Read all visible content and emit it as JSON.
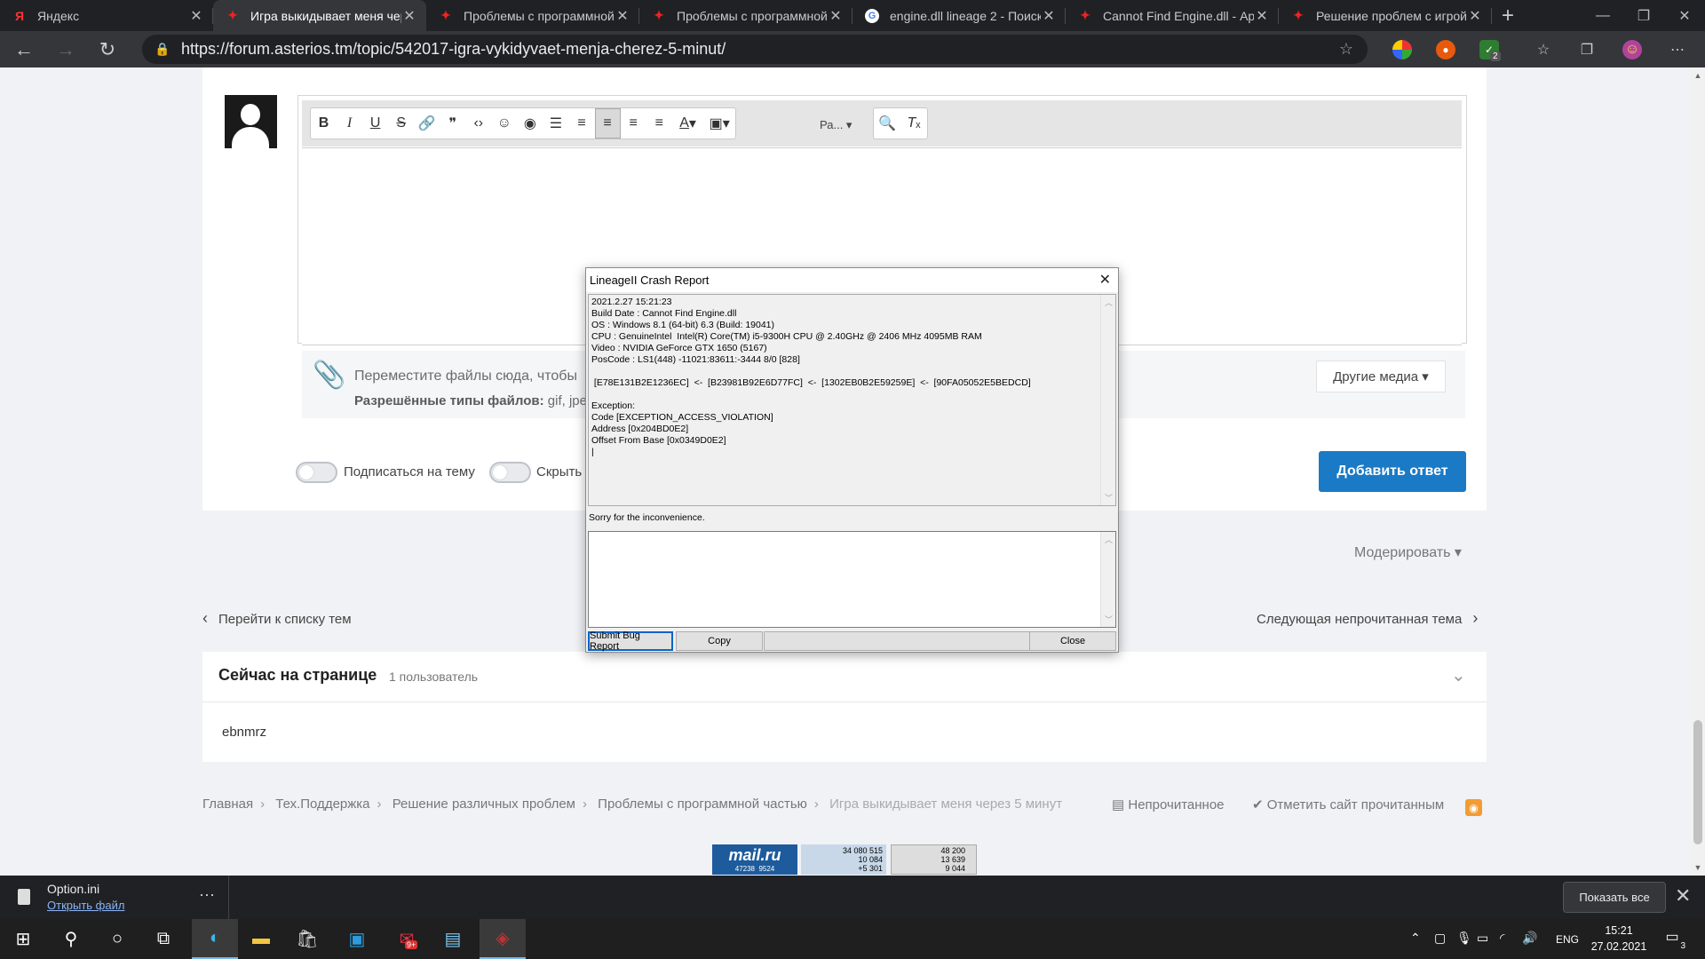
{
  "browser": {
    "tabs": [
      {
        "title": "Яндекс",
        "favicon": "yandex-icon",
        "active": false
      },
      {
        "title": "Игра выкидывает меня чере",
        "favicon": "asterios-icon",
        "active": true
      },
      {
        "title": "Проблемы с программной",
        "favicon": "asterios-icon",
        "active": false
      },
      {
        "title": "Проблемы с программной",
        "favicon": "asterios-icon",
        "active": false
      },
      {
        "title": "engine.dll lineage 2 - Поиск",
        "favicon": "google-icon",
        "active": false
      },
      {
        "title": "Cannot Find Engine.dll - Ар",
        "favicon": "asterios-icon",
        "active": false
      },
      {
        "title": "Решение проблем с игрой",
        "favicon": "asterios-icon",
        "active": false
      }
    ],
    "url": "https://forum.asterios.tm/topic/542017-igra-vykidyvaet-menja-cherez-5-minut/",
    "extension_badge": "2"
  },
  "editor": {
    "font_menu_label": "Ра...",
    "attach_text": "Переместите файлы сюда, чтобы",
    "allowed_label": "Разрешённые типы файлов:",
    "allowed_types": "gif, jpeg",
    "other_media_label": "Другие медиа ▾",
    "subscribe_label": "Подписаться на тему",
    "hide_label": "Скрыть",
    "submit_label": "Добавить ответ"
  },
  "page": {
    "moderate_label": "Модерировать ▾",
    "back_to_list": "Перейти к списку тем",
    "next_unread": "Следующая непрочитанная тема",
    "online_title": "Сейчас на странице",
    "online_count": "1 пользователь",
    "online_user": "ebnmrz",
    "breadcrumbs": [
      "Главная",
      "Тех.Поддержка",
      "Решение различных проблем",
      "Проблемы с программной частью",
      "Игра выкидывает меня через 5 минут"
    ],
    "unread_link": "Непрочитанное",
    "mark_read_link": "Отметить сайт прочитанным",
    "counter_mailru": "mail.ru",
    "counter_mailru_nums": [
      "47238",
      "9524"
    ],
    "counter_hotlog_nums": [
      "34 080 515",
      "10 084",
      "+5 301"
    ],
    "counter_li_nums": [
      "48 200",
      "13 639",
      "9 044"
    ]
  },
  "dialog": {
    "title": "LineageII Crash Report",
    "log": "2021.2.27 15:21:23\nBuild Date : Cannot Find Engine.dll\nOS : Windows 8.1 (64-bit) 6.3 (Build: 19041)\nCPU : GenuineIntel  Intel(R) Core(TM) i5-9300H CPU @ 2.40GHz @ 2406 MHz 4095MB RAM\nVideo : NVIDIA GeForce GTX 1650 (5167)\nPosCode : LS1(448) -11021:83611:-3444 8/0 [828]\n\n [E78E131B2E1236EC]  <-  [B23981B92E6D77FC]  <-  [1302EB0B2E59259E]  <-  [90FA05052E5BEDCD]\n\nException:\nCode [EXCEPTION_ACCESS_VIOLATION]\nAddress [0x204BD0E2]\nOffset From Base [0x0349D0E2]\n|",
    "sorry": "Sorry for the inconvenience.",
    "submit_label": "Submit Bug Report",
    "copy_label": "Copy",
    "close_label": "Close"
  },
  "downloads": {
    "file_name": "Option.ini",
    "open_label": "Открыть файл",
    "show_all_label": "Показать все"
  },
  "taskbar": {
    "lang": "ENG",
    "time": "15:21",
    "date": "27.02.2021",
    "notif_count": "3",
    "mail_badge": "9+"
  }
}
